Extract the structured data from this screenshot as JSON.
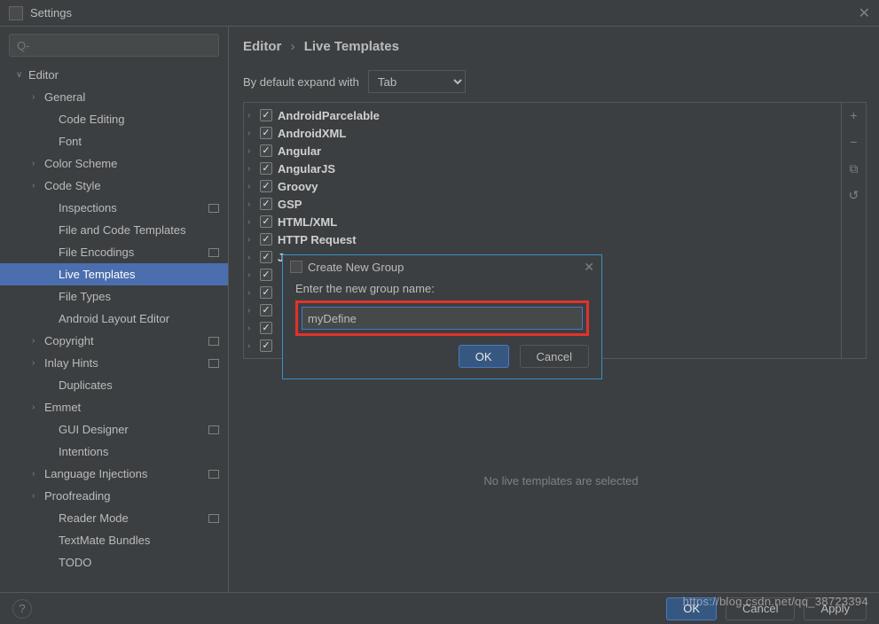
{
  "window": {
    "title": "Settings",
    "close": "✕"
  },
  "search": {
    "placeholder": "Q-"
  },
  "sidebar": [
    {
      "label": "Editor",
      "level": 1,
      "arrow": "∨",
      "badge": false
    },
    {
      "label": "General",
      "level": 2,
      "arrow": "›",
      "badge": false
    },
    {
      "label": "Code Editing",
      "level": 3,
      "arrow": "",
      "badge": false
    },
    {
      "label": "Font",
      "level": 3,
      "arrow": "",
      "badge": false
    },
    {
      "label": "Color Scheme",
      "level": 2,
      "arrow": "›",
      "badge": false
    },
    {
      "label": "Code Style",
      "level": 2,
      "arrow": "›",
      "badge": false
    },
    {
      "label": "Inspections",
      "level": 3,
      "arrow": "",
      "badge": true
    },
    {
      "label": "File and Code Templates",
      "level": 3,
      "arrow": "",
      "badge": false
    },
    {
      "label": "File Encodings",
      "level": 3,
      "arrow": "",
      "badge": true
    },
    {
      "label": "Live Templates",
      "level": 3,
      "arrow": "",
      "badge": false,
      "selected": true
    },
    {
      "label": "File Types",
      "level": 3,
      "arrow": "",
      "badge": false
    },
    {
      "label": "Android Layout Editor",
      "level": 3,
      "arrow": "",
      "badge": false
    },
    {
      "label": "Copyright",
      "level": 2,
      "arrow": "›",
      "badge": true
    },
    {
      "label": "Inlay Hints",
      "level": 2,
      "arrow": "›",
      "badge": true
    },
    {
      "label": "Duplicates",
      "level": 3,
      "arrow": "",
      "badge": false
    },
    {
      "label": "Emmet",
      "level": 2,
      "arrow": "›",
      "badge": false
    },
    {
      "label": "GUI Designer",
      "level": 3,
      "arrow": "",
      "badge": true
    },
    {
      "label": "Intentions",
      "level": 3,
      "arrow": "",
      "badge": false
    },
    {
      "label": "Language Injections",
      "level": 2,
      "arrow": "›",
      "badge": true
    },
    {
      "label": "Proofreading",
      "level": 2,
      "arrow": "›",
      "badge": false
    },
    {
      "label": "Reader Mode",
      "level": 3,
      "arrow": "",
      "badge": true
    },
    {
      "label": "TextMate Bundles",
      "level": 3,
      "arrow": "",
      "badge": false
    },
    {
      "label": "TODO",
      "level": 3,
      "arrow": "",
      "badge": false
    }
  ],
  "breadcrumb": {
    "a": "Editor",
    "sep": "›",
    "b": "Live Templates"
  },
  "expand": {
    "label": "By default expand with",
    "value": "Tab"
  },
  "templates": [
    {
      "label": "AndroidParcelable"
    },
    {
      "label": "AndroidXML"
    },
    {
      "label": "Angular"
    },
    {
      "label": "AngularJS"
    },
    {
      "label": "Groovy"
    },
    {
      "label": "GSP"
    },
    {
      "label": "HTML/XML"
    },
    {
      "label": "HTTP Request"
    },
    {
      "label": "Java"
    },
    {
      "label": ""
    },
    {
      "label": ""
    },
    {
      "label": ""
    },
    {
      "label": ""
    },
    {
      "label": ""
    }
  ],
  "tools": {
    "add": "+",
    "remove": "−",
    "copy": "⧉",
    "undo": "↺"
  },
  "status": "No live templates are selected",
  "footer": {
    "help": "?",
    "ok": "OK",
    "cancel": "Cancel",
    "apply": "Apply"
  },
  "dialog": {
    "title": "Create New Group",
    "close": "✕",
    "label": "Enter the new group name:",
    "value": "myDefine",
    "ok": "OK",
    "cancel": "Cancel"
  },
  "watermark": "https://blog.csdn.net/qq_38723394"
}
